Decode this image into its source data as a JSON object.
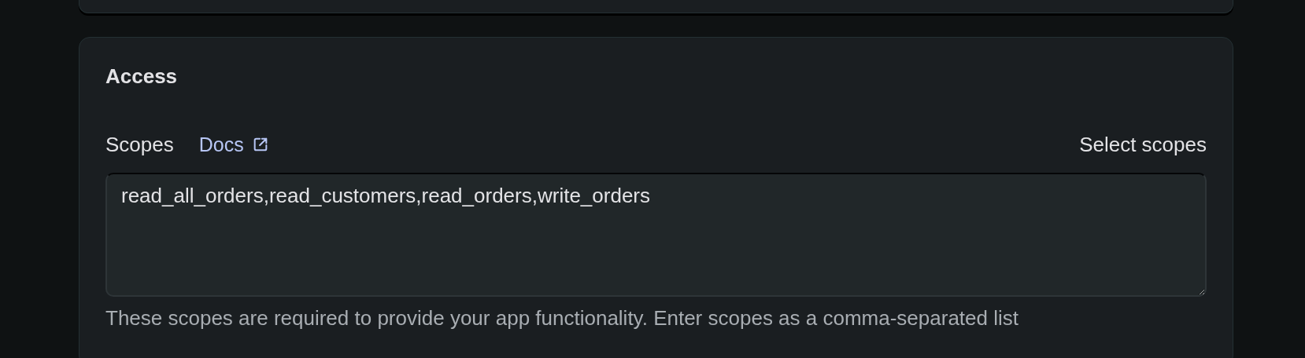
{
  "section": {
    "title": "Access",
    "scopes": {
      "label": "Scopes",
      "docs_link": "Docs",
      "select_button": "Select scopes",
      "value": "read_all_orders,read_customers,read_orders,write_orders",
      "help": "These scopes are required to provide your app functionality. Enter scopes as a comma-separated list"
    }
  }
}
